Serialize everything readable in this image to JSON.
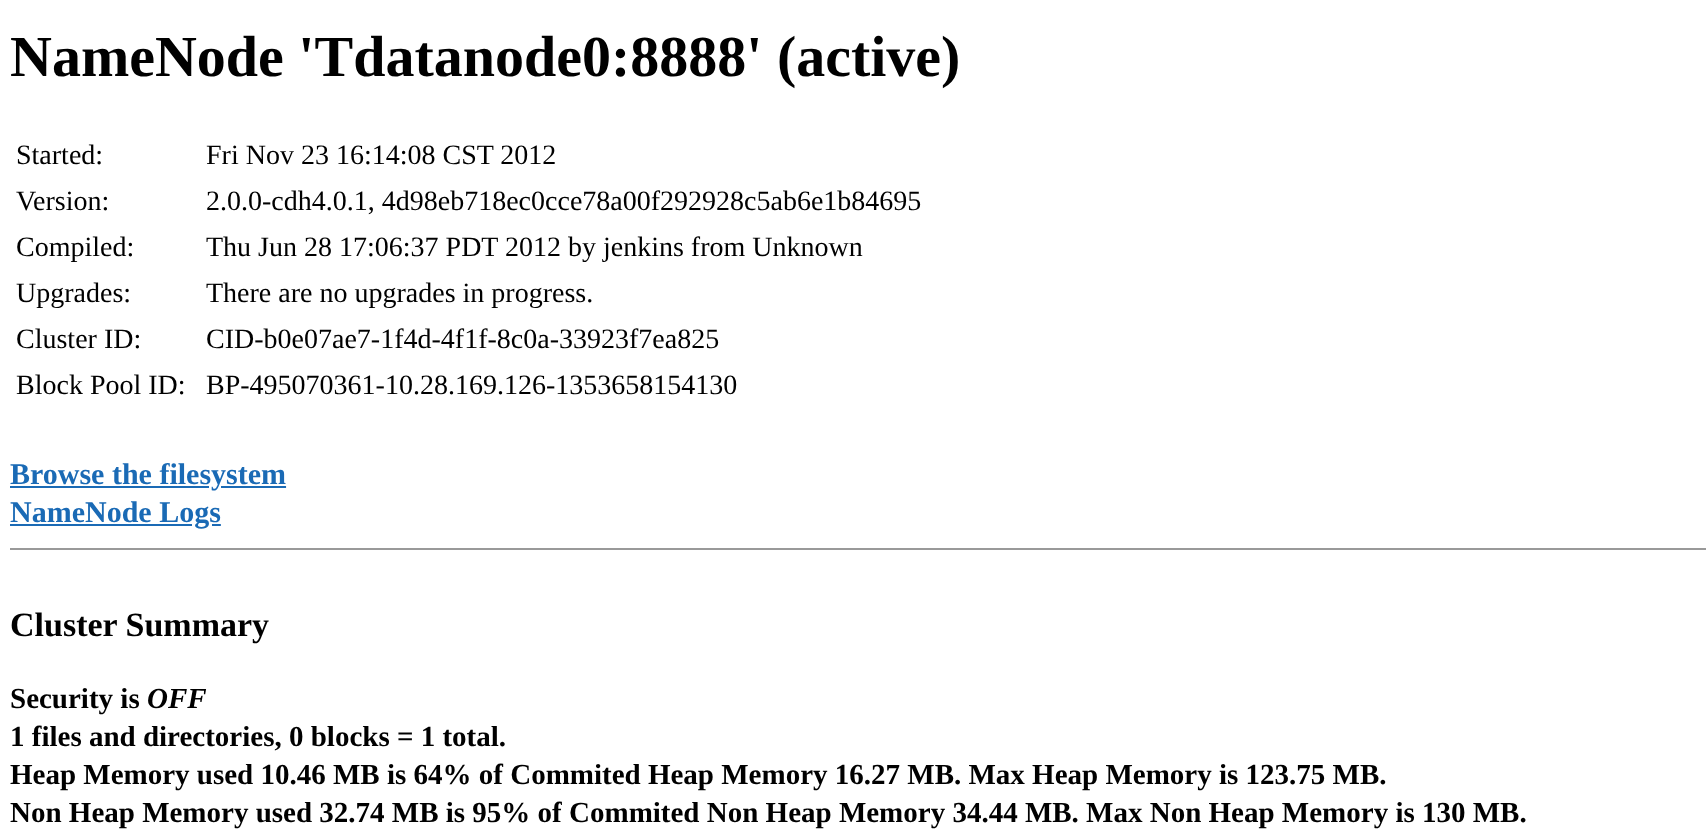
{
  "title": "NameNode 'Tdatanode0:8888' (active)",
  "info": [
    {
      "label": "Started:",
      "value": "Fri Nov 23 16:14:08 CST 2012"
    },
    {
      "label": "Version:",
      "value": "2.0.0-cdh4.0.1, 4d98eb718ec0cce78a00f292928c5ab6e1b84695"
    },
    {
      "label": "Compiled:",
      "value": "Thu Jun 28 17:06:37 PDT 2012 by jenkins from Unknown"
    },
    {
      "label": "Upgrades:",
      "value": "There are no upgrades in progress."
    },
    {
      "label": "Cluster ID:",
      "value": "CID-b0e07ae7-1f4d-4f1f-8c0a-33923f7ea825"
    },
    {
      "label": "Block Pool ID:",
      "value": "BP-495070361-10.28.169.126-1353658154130"
    }
  ],
  "links": [
    "Browse the filesystem",
    "NameNode Logs"
  ],
  "summary": {
    "heading": "Cluster Summary",
    "lines": [
      "Security is *OFF*",
      "1 files and directories, 0 blocks = 1 total.",
      "Heap Memory used 10.46 MB is 64% of Commited Heap Memory 16.27 MB. Max Heap Memory is 123.75 MB.",
      "Non Heap Memory used 32.74 MB is 95% of Commited Non Heap Memory 34.44 MB. Max Non Heap Memory is 130 MB."
    ]
  }
}
